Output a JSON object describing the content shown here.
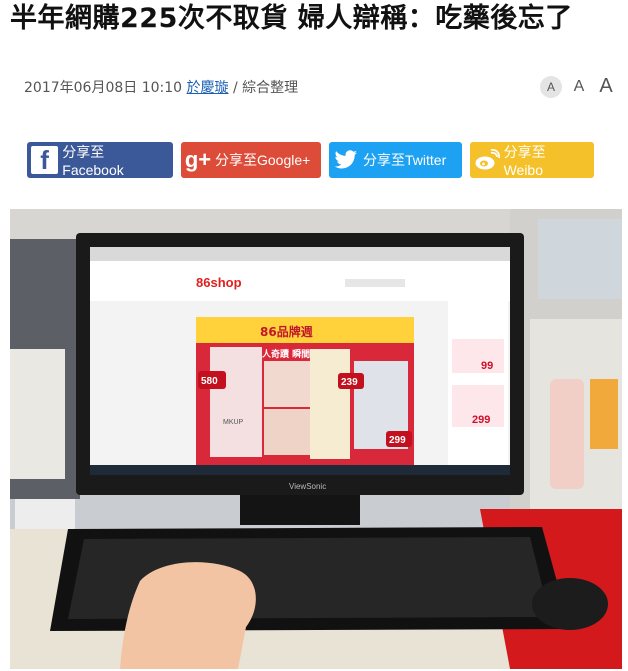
{
  "article": {
    "title": "半年網購225次不取貨 婦人辯稱：吃藥後忘了",
    "date": "2017年06月08日 10:10",
    "author": "於慶璇",
    "source": " / 綜合整理"
  },
  "font_size_controls": [
    "A",
    "A",
    "A"
  ],
  "share_buttons": [
    {
      "label": "分享至Facebook",
      "icon": "f",
      "color": "#3b5998"
    },
    {
      "label": "分享至Google+",
      "icon": "g+",
      "color": "#dd4b39"
    },
    {
      "label": "分享至Twitter",
      "icon": "twitter-bird",
      "color": "#1da1f2"
    },
    {
      "label": "分享至Weibo",
      "icon": "weibo",
      "color": "#f5c12b"
    }
  ],
  "photo": {
    "monitor_brand": "ViewSonic",
    "screen": {
      "logo": "86shop",
      "banner_headline": "86品牌週",
      "banner_sub": "懶人奇蹟 瞬間美麗",
      "product": "MKUP",
      "prices": [
        "580",
        "239",
        "299",
        "99",
        "299"
      ]
    }
  }
}
